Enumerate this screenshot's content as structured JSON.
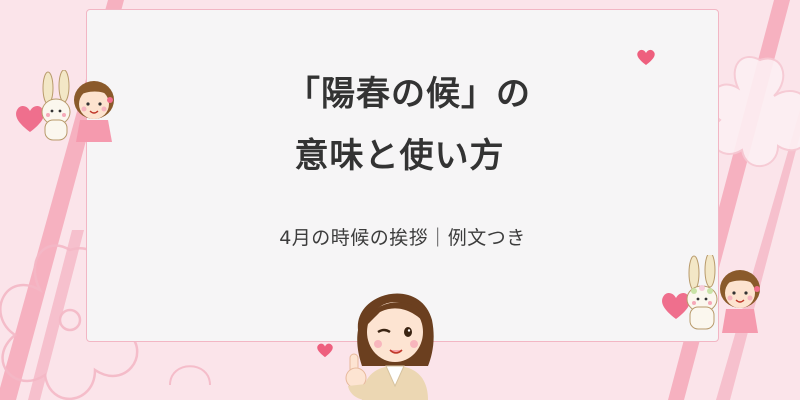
{
  "title": {
    "line1": "「陽春の候」の",
    "line2": "意味と使い方"
  },
  "subtitle": "4月の時候の挨拶｜例文つき",
  "colors": {
    "background": "#fbe4ea",
    "card": "#f6f5f6",
    "card_border": "#f2b6c4",
    "stripe": "#f5a9ba",
    "heart": "#ee5f7e",
    "text": "#333333"
  },
  "icons": [
    "sakura-flower-icon",
    "heart-icon",
    "bunny-illustration",
    "girl-illustration",
    "woman-winking-illustration"
  ]
}
